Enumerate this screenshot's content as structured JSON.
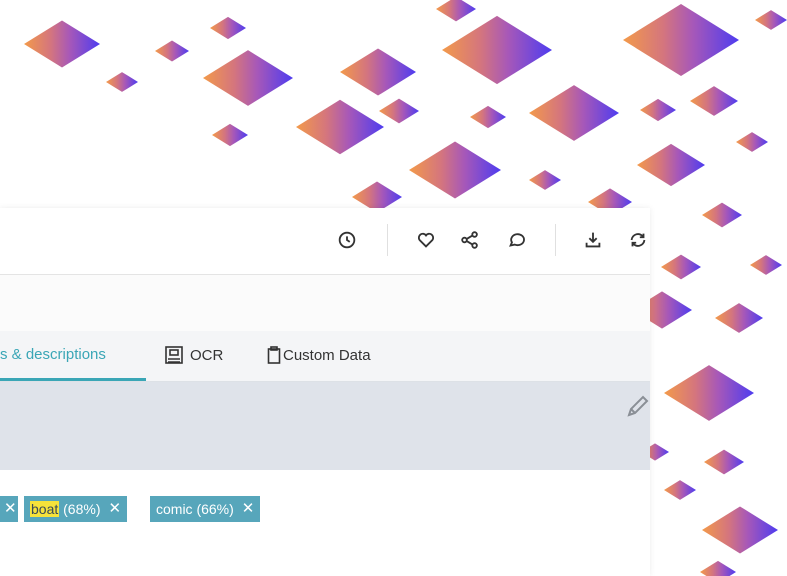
{
  "colors": {
    "accent": "#3aa6b6",
    "tag_bg": "#57a6bb",
    "highlight": "#f6e23a",
    "description_bg": "#dfe3ea"
  },
  "toolbar": {
    "icons": [
      "clock-icon",
      "heart-icon",
      "share-icon",
      "comment-icon",
      "download-icon",
      "refresh-icon"
    ]
  },
  "tabs": [
    {
      "label": "s & descriptions",
      "active": true
    },
    {
      "label": "OCR",
      "icon": "ocr-icon"
    },
    {
      "label": "Custom Data",
      "icon": "clipboard-icon"
    }
  ],
  "tags": [
    {
      "match": "boat",
      "rest": " (68%)"
    },
    {
      "label": "comic (66%)"
    }
  ],
  "tag_close_glyph": "✕"
}
